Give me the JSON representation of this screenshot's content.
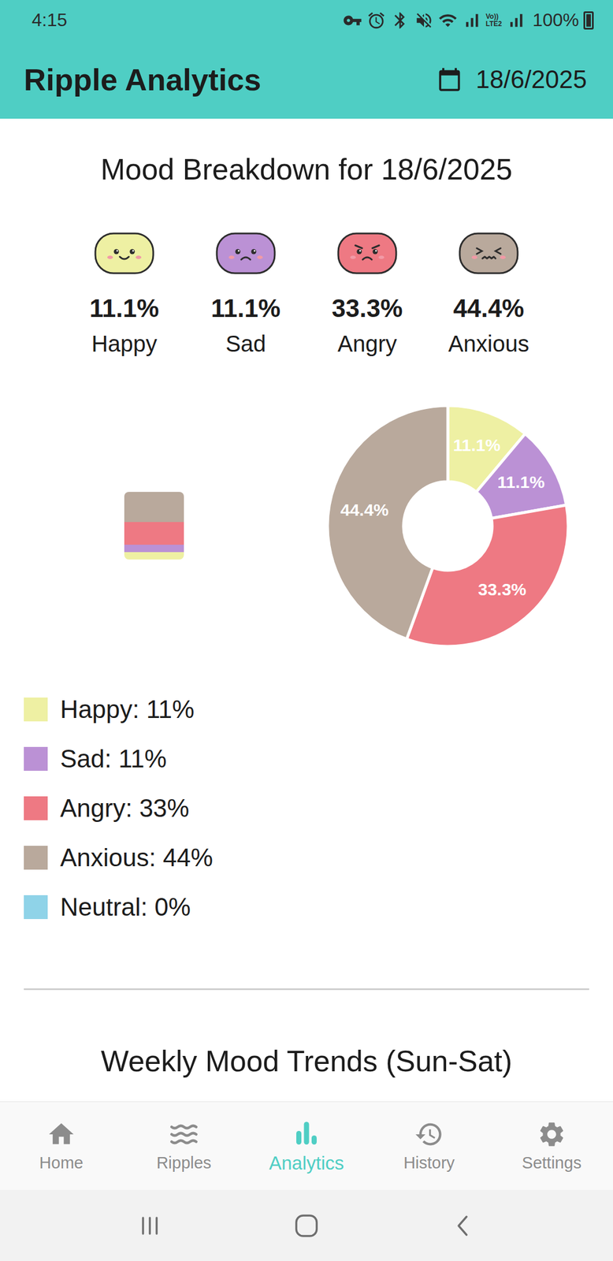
{
  "status_bar": {
    "time": "4:15",
    "network_label": [
      "Vo))",
      "LTE2"
    ],
    "battery": "100%",
    "battery_level": 1
  },
  "app_bar": {
    "title": "Ripple Analytics",
    "date": "18/6/2025"
  },
  "breakdown": {
    "title": "Mood Breakdown for 18/6/2025",
    "moods": [
      {
        "kind": "happy",
        "percent": "11.1%",
        "label": "Happy",
        "color": "#eef0a3"
      },
      {
        "kind": "sad",
        "percent": "11.1%",
        "label": "Sad",
        "color": "#bb91d5"
      },
      {
        "kind": "angry",
        "percent": "33.3%",
        "label": "Angry",
        "color": "#ee7983"
      },
      {
        "kind": "anxious",
        "percent": "44.4%",
        "label": "Anxious",
        "color": "#b9a99c"
      }
    ]
  },
  "chart": {
    "slices": [
      {
        "value": 11.1,
        "label": "11.1%",
        "color": "#eef0a3"
      },
      {
        "value": 11.1,
        "label": "11.1%",
        "color": "#bb91d5"
      },
      {
        "value": 33.3,
        "label": "33.3%",
        "color": "#ee7983"
      },
      {
        "value": 44.4,
        "label": "44.4%",
        "color": "#b9a99c"
      }
    ]
  },
  "legend": [
    {
      "label": "Happy: 11%",
      "color": "#eef0a3"
    },
    {
      "label": "Sad: 11%",
      "color": "#bb91d5"
    },
    {
      "label": "Angry: 33%",
      "color": "#ee7983"
    },
    {
      "label": "Anxious: 44%",
      "color": "#b9a99c"
    },
    {
      "label": "Neutral: 0%",
      "color": "#8fd3e8"
    }
  ],
  "weekly": {
    "title": "Weekly Mood Trends (Sun-Sat)"
  },
  "nav": [
    {
      "label": "Home",
      "selected": false
    },
    {
      "label": "Ripples",
      "selected": false
    },
    {
      "label": "Analytics",
      "selected": true
    },
    {
      "label": "History",
      "selected": false
    },
    {
      "label": "Settings",
      "selected": false
    }
  ]
}
